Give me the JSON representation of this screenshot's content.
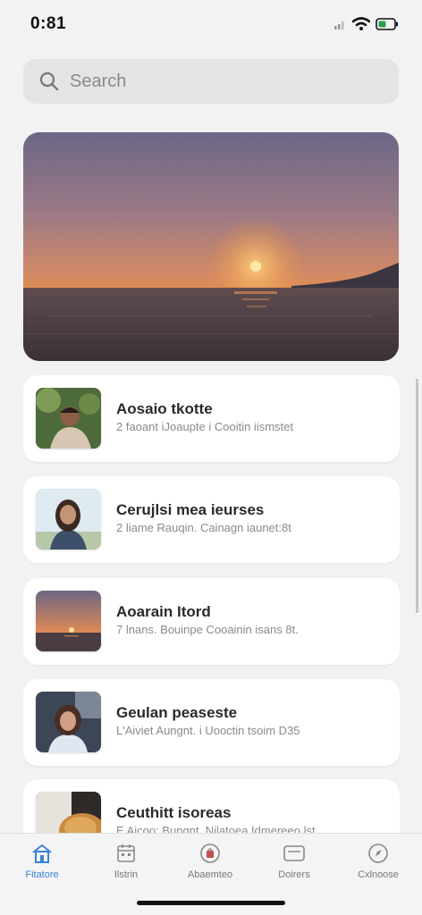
{
  "status_bar": {
    "time": "0:81"
  },
  "search": {
    "placeholder": "Search"
  },
  "hero": {
    "icon": "sunset-photo"
  },
  "list": {
    "items": [
      {
        "title": "Aosaio tkotte",
        "subtitle": "2 faoant iJoaupte i Cooitin iismstet",
        "thumb": "person-photo"
      },
      {
        "title": "Cerujlsi mea ieurses",
        "subtitle": "2 liame Rauqin. Cainagn iaunet:8t",
        "thumb": "woman-portrait-photo"
      },
      {
        "title": "Aoarain Itord",
        "subtitle": "7 lnans. Bouinpe Cooainin isans 8t.",
        "thumb": "sunset-photo"
      },
      {
        "title": "Geulan peaseste",
        "subtitle": "L'Aiviet Aungnt. i Uooctin tsoim D35",
        "thumb": "woman-photo"
      },
      {
        "title": "Ceuthitt isoreas",
        "subtitle": "E Aicoo: Bungnt. Nilatoea Idmereeo lst",
        "thumb": "food-photo"
      }
    ]
  },
  "tab_bar": {
    "tabs": [
      {
        "label": "Fitatore",
        "icon": "home-icon",
        "active": true
      },
      {
        "label": "Ilstrin",
        "icon": "calendar-icon",
        "active": false
      },
      {
        "label": "Abaemteo",
        "icon": "bag-icon",
        "active": false
      },
      {
        "label": "Doirers",
        "icon": "message-icon",
        "active": false
      },
      {
        "label": "Cxlnoose",
        "icon": "compass-icon",
        "active": false
      }
    ]
  },
  "colors": {
    "accent": "#3b82d6",
    "background": "#f2f2f3",
    "card": "#ffffff"
  }
}
